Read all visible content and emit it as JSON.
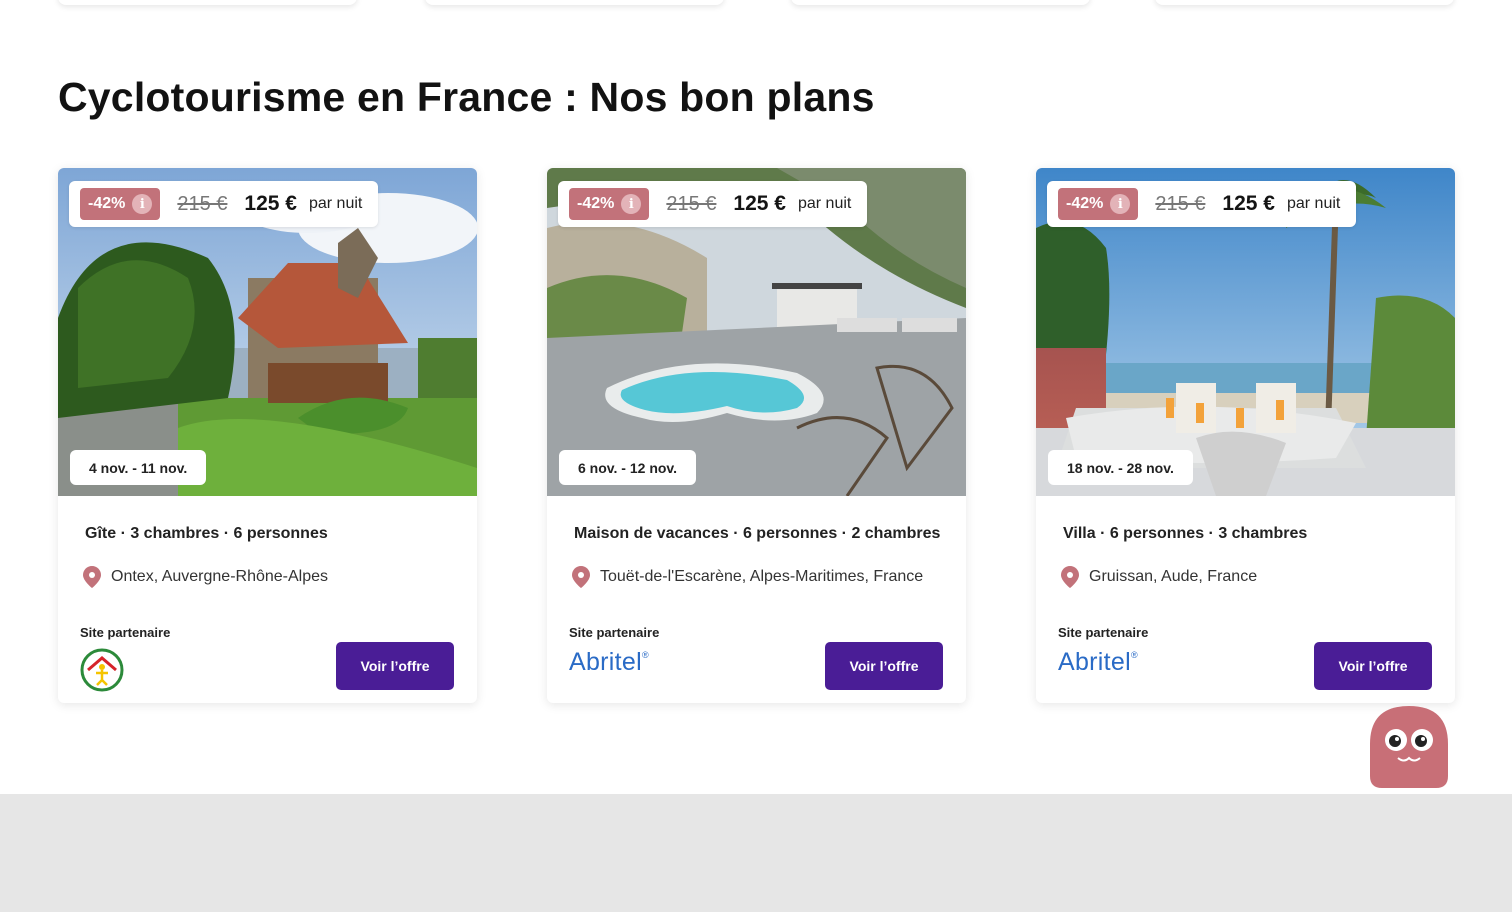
{
  "section": {
    "title": "Cyclotourisme en France : Nos bon plans"
  },
  "cards": [
    {
      "discount": "-42%",
      "old_price": "215 €",
      "new_price": "125 €",
      "per_night": "par nuit",
      "dates": "4 nov. - 11 nov.",
      "title": "Gîte · 3 chambres · 6 personnes",
      "location": "Ontex, Auvergne-Rhône-Alpes",
      "partner_label": "Site partenaire",
      "partner_logo": "gites-de-france-logo",
      "button": "Voir l’offre"
    },
    {
      "discount": "-42%",
      "old_price": "215 €",
      "new_price": "125 €",
      "per_night": "par nuit",
      "dates": "6 nov. - 12 nov.",
      "title": "Maison de vacances · 6 personnes · 2 chambres",
      "location": "Touët-de-l'Escarène, Alpes-Maritimes, France",
      "partner_label": "Site partenaire",
      "partner_logo": "Abritel",
      "button": "Voir l’offre"
    },
    {
      "discount": "-42%",
      "old_price": "215 €",
      "new_price": "125 €",
      "per_night": "par nuit",
      "dates": "18 nov. - 28 nov.",
      "title": "Villa · 6 personnes · 3 chambres",
      "location": "Gruissan, Aude, France",
      "partner_label": "Site partenaire",
      "partner_logo": "Abritel",
      "button": "Voir l’offre"
    }
  ],
  "colors": {
    "accent_button": "#4a1d96",
    "discount_badge": "#c2727a",
    "pin": "#c2727a",
    "abritel_blue": "#2a6bc6",
    "footer_band": "#e6e6e6"
  },
  "icons": [
    "info-icon",
    "location-pin-icon",
    "chat-mascot-icon"
  ]
}
